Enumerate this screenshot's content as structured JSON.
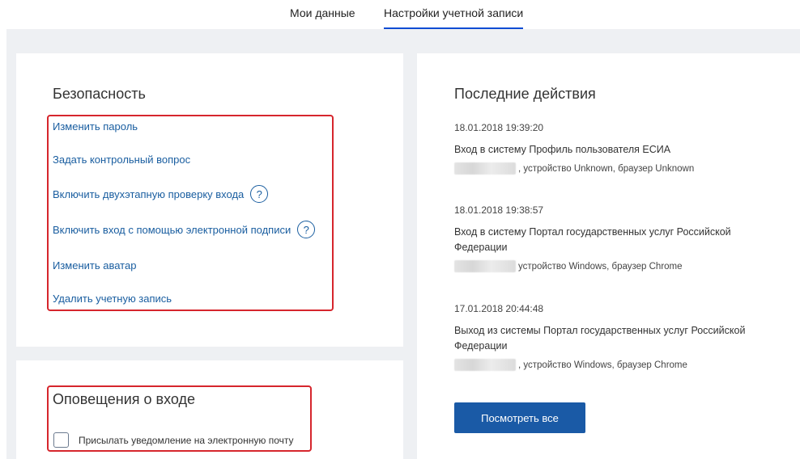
{
  "tabs": [
    {
      "label": "Мои данные"
    },
    {
      "label": "Настройки учетной записи"
    }
  ],
  "security": {
    "title": "Безопасность",
    "links": [
      {
        "label": "Изменить пароль"
      },
      {
        "label": "Задать контрольный вопрос"
      },
      {
        "label": "Включить двухэтапную проверку входа",
        "help": "?"
      },
      {
        "label": "Включить вход с помощью электронной подписи",
        "help": "?"
      },
      {
        "label": "Изменить аватар"
      },
      {
        "label": "Удалить учетную запись"
      }
    ]
  },
  "notify": {
    "title": "Оповещения о входе",
    "checkbox_label": "Присылать уведомление на электронную почту",
    "checked": false
  },
  "actions": {
    "title": "Последние действия",
    "items": [
      {
        "date": "18.01.2018 19:39:20",
        "title": "Вход в систему Профиль пользователя ЕСИА",
        "device": ", устройство Unknown, браузер Unknown"
      },
      {
        "date": "18.01.2018 19:38:57",
        "title": "Вход в систему Портал государственных услуг Российской Федерации",
        "device": "устройство Windows, браузер Chrome"
      },
      {
        "date": "17.01.2018 20:44:48",
        "title": "Выход из системы Портал государственных услуг Российской Федерации",
        "device": ", устройство Windows, браузер Chrome"
      }
    ],
    "view_all_label": "Посмотреть все"
  },
  "colors": {
    "accent": "#1a5aa6",
    "link": "#1a5ea0",
    "highlight": "#d6262d"
  }
}
